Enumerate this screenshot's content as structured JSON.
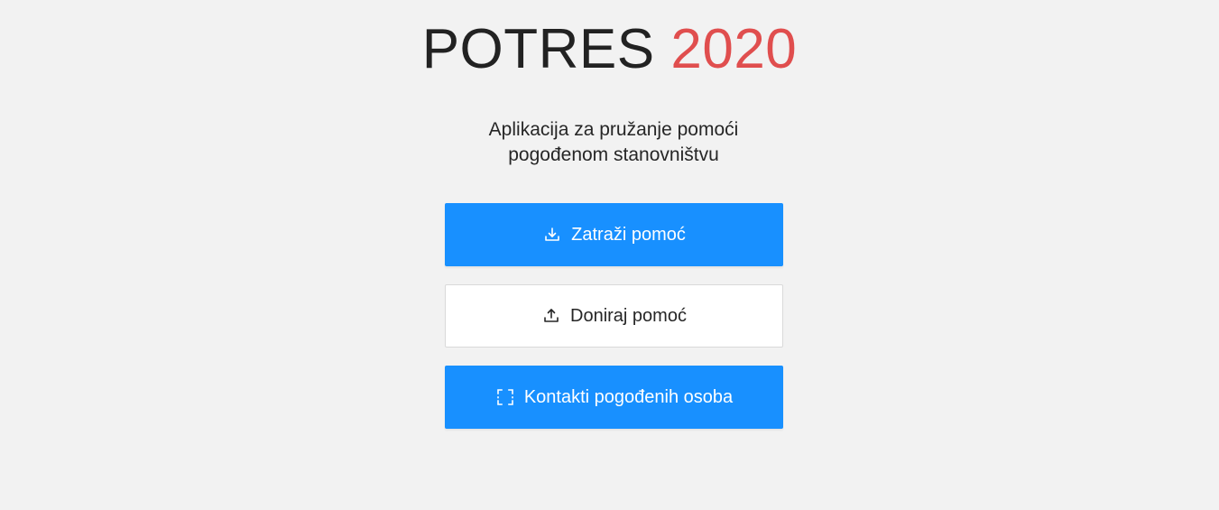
{
  "header": {
    "title_main": "POTRES",
    "title_year": "2020",
    "subtitle_line1": "Aplikacija za pružanje pomoći",
    "subtitle_line2": "pogođenom stanovništvu"
  },
  "actions": {
    "request_help": {
      "label": "Zatraži pomoć",
      "icon": "download-icon"
    },
    "donate_help": {
      "label": "Doniraj pomoć",
      "icon": "upload-icon"
    },
    "contacts": {
      "label": "Kontakti pogođenih osoba",
      "icon": "scan-icon"
    }
  },
  "colors": {
    "primary": "#1890ff",
    "accent_red": "#e04e4e",
    "background": "#f2f2f2",
    "text": "#222222"
  }
}
